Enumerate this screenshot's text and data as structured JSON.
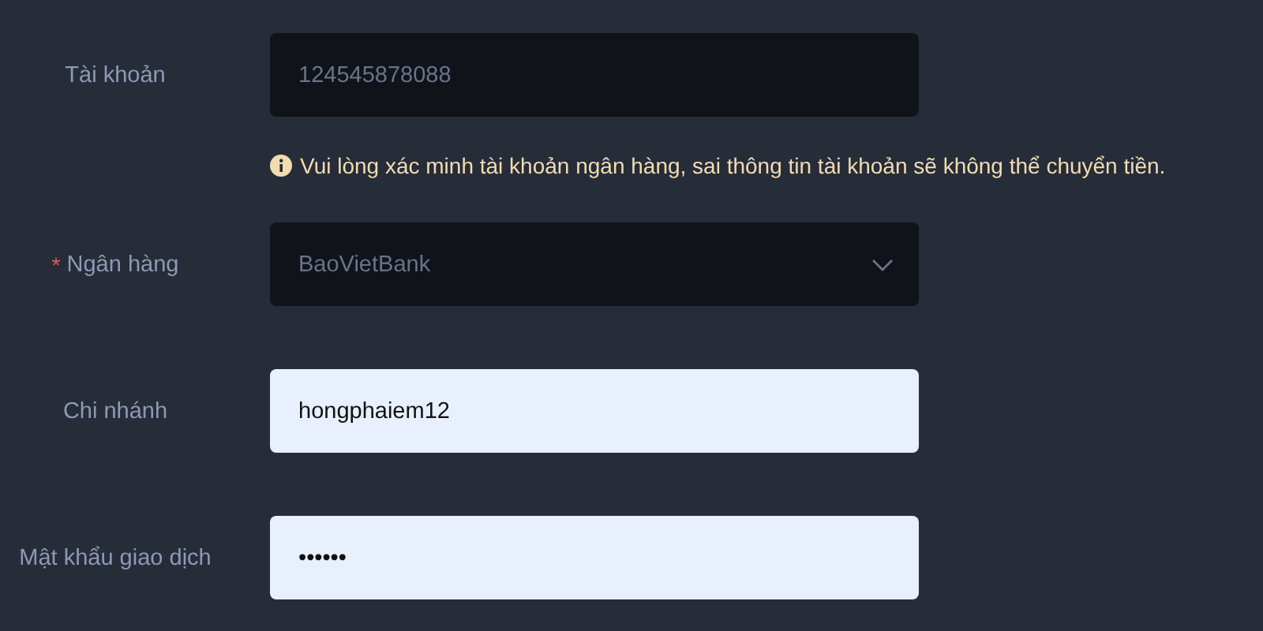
{
  "fields": [
    {
      "label": "Tài khoản",
      "kind": "text",
      "disabled": true,
      "value": "124545878088",
      "hint": "Vui lòng xác minh tài khoản ngân hàng, sai thông tin tài khoản sẽ không thể chuyển tiền."
    },
    {
      "label": "Ngân hàng",
      "required_mark": "*",
      "kind": "select",
      "disabled": true,
      "value": "BaoVietBank"
    },
    {
      "label": "Chi nhánh",
      "kind": "text",
      "disabled": false,
      "value": "hongphaiem12"
    },
    {
      "label": "Mật khẩu giao dịch",
      "kind": "password",
      "disabled": false,
      "value": "••••••"
    }
  ]
}
